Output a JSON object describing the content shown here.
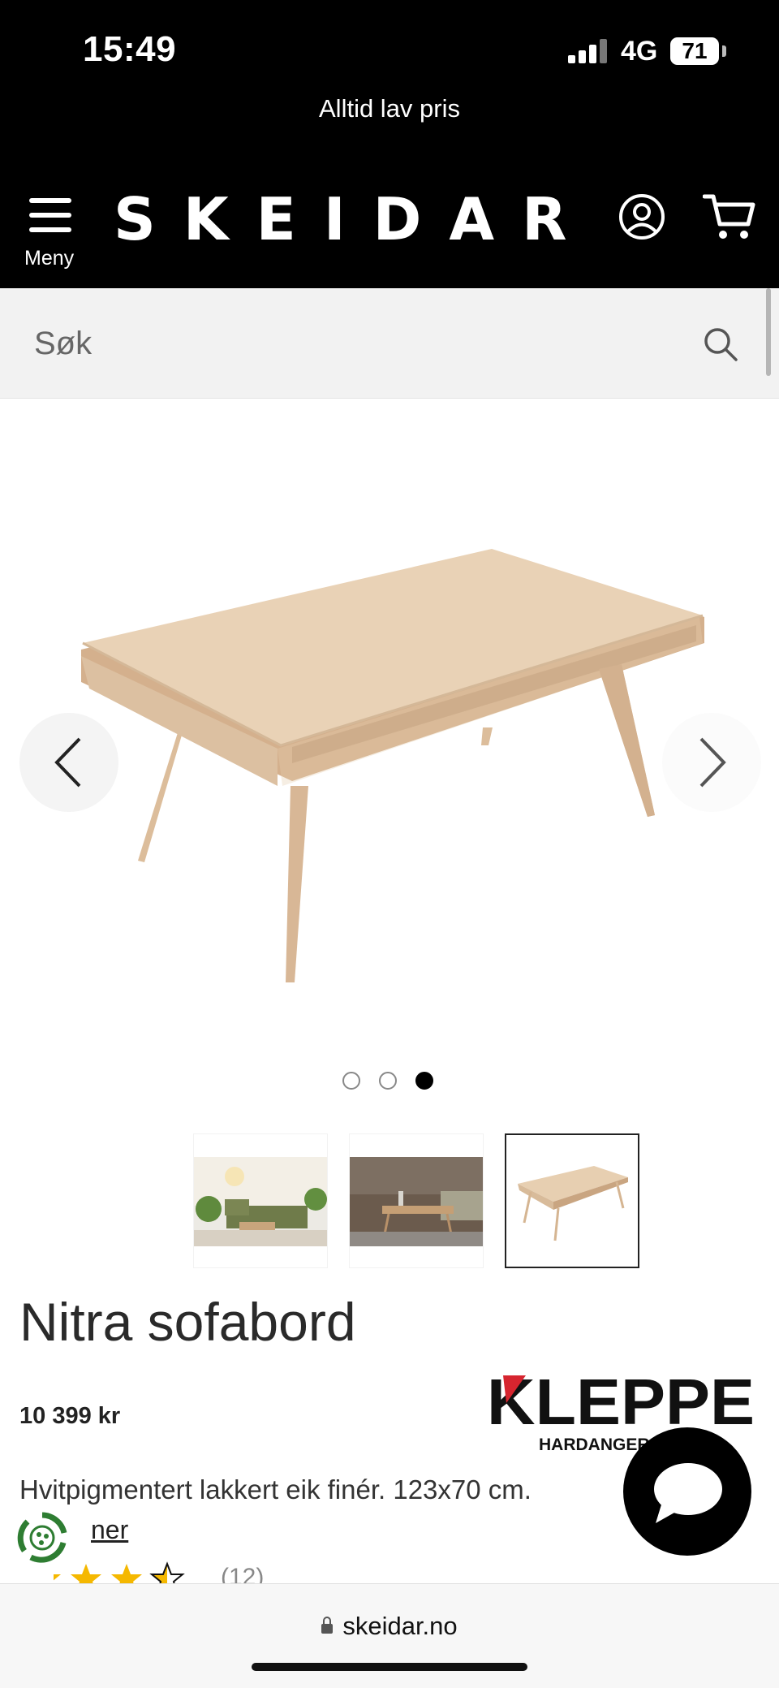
{
  "status_bar": {
    "time": "15:49",
    "network": "4G",
    "battery": "71"
  },
  "promo": {
    "text": "Alltid lav pris"
  },
  "header": {
    "menu_label": "Meny",
    "logo": "SKEIDAR"
  },
  "search": {
    "placeholder": "Søk"
  },
  "gallery": {
    "dots_count": 3,
    "active_dot": 3,
    "thumbnails_count": 3,
    "selected_thumbnail": 3
  },
  "product": {
    "title": "Nitra sofabord",
    "price": "10 399 kr",
    "brand_name": "KLEPPE",
    "brand_tagline": "HARDANGER M",
    "description": "Hvitpigmentert lakkert eik finér. 123x70 cm.",
    "more_link": "ner",
    "rating": 3.5,
    "review_count": "(12)"
  },
  "browser": {
    "url": "skeidar.no"
  },
  "colors": {
    "header_bg": "#000000",
    "search_bg": "#f2f2f2",
    "star": "#f5b800",
    "brand_red": "#d6252f"
  }
}
